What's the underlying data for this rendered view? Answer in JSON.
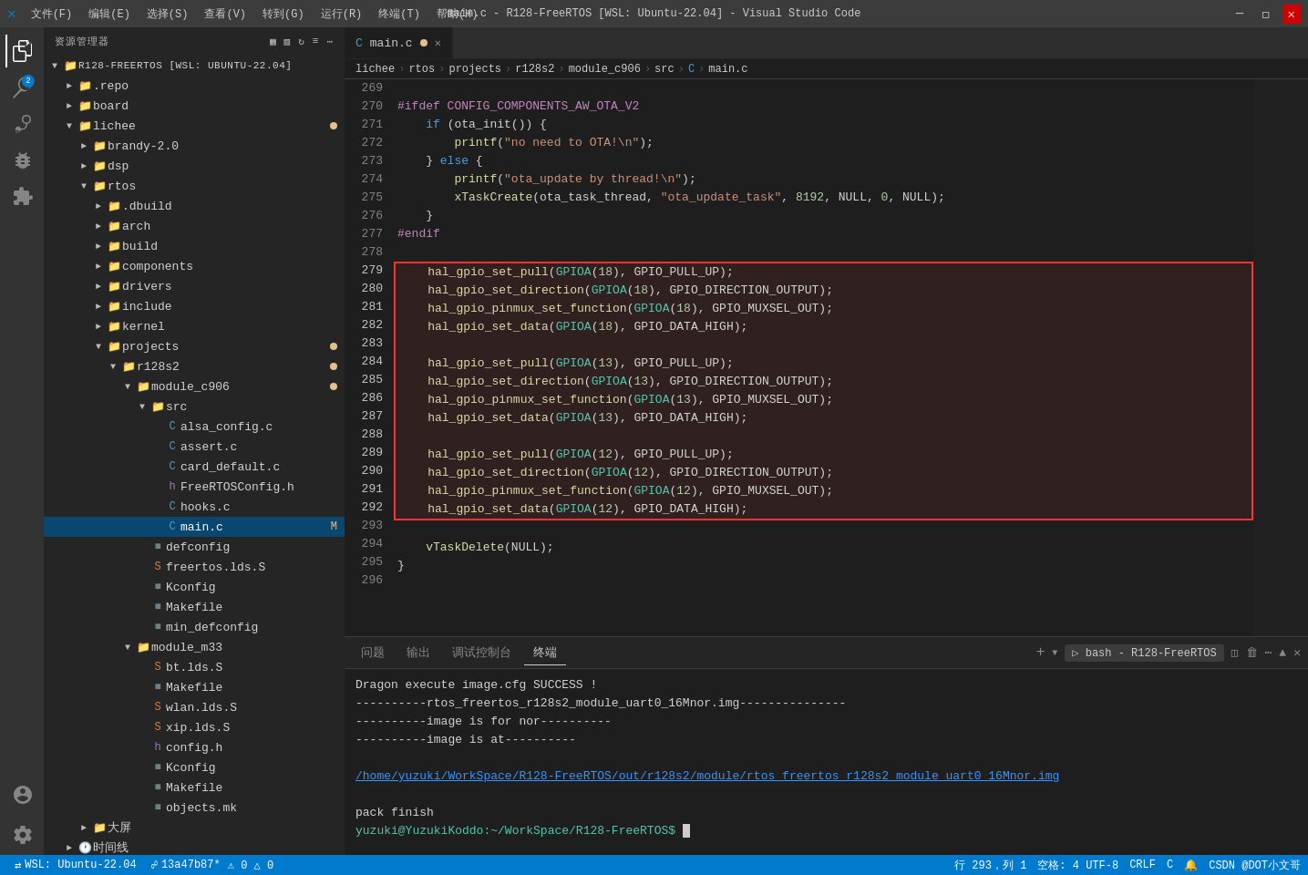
{
  "titlebar": {
    "title": "main.c - R128-FreeRTOS [WSL: Ubuntu-22.04] - Visual Studio Code",
    "menus": [
      "文件(F)",
      "编辑(E)",
      "选择(S)",
      "查看(V)",
      "转到(G)",
      "运行(R)",
      "终端(T)",
      "帮助(H)"
    ]
  },
  "sidebar": {
    "header": "资源管理器",
    "root": "R128-FREERTOS [WSL: UBUNTU-22.04]",
    "tree": [
      {
        "id": "repo",
        "label": ".repo",
        "type": "folder",
        "depth": 1,
        "expanded": false
      },
      {
        "id": "board",
        "label": "board",
        "type": "folder",
        "depth": 1,
        "expanded": false
      },
      {
        "id": "lichee",
        "label": "lichee",
        "type": "folder",
        "depth": 1,
        "expanded": true,
        "modified": true
      },
      {
        "id": "brandy",
        "label": "brandy-2.0",
        "type": "folder",
        "depth": 2,
        "expanded": false
      },
      {
        "id": "dsp",
        "label": "dsp",
        "type": "folder",
        "depth": 2,
        "expanded": false
      },
      {
        "id": "rtos",
        "label": "rtos",
        "type": "folder",
        "depth": 2,
        "expanded": true
      },
      {
        "id": "dbuild",
        "label": ".dbuild",
        "type": "folder",
        "depth": 3,
        "expanded": false
      },
      {
        "id": "arch",
        "label": "arch",
        "type": "folder",
        "depth": 3,
        "expanded": false
      },
      {
        "id": "build",
        "label": "build",
        "type": "folder",
        "depth": 3,
        "expanded": false,
        "special": true
      },
      {
        "id": "components",
        "label": "components",
        "type": "folder",
        "depth": 3,
        "expanded": false
      },
      {
        "id": "drivers",
        "label": "drivers",
        "type": "folder",
        "depth": 3,
        "expanded": false
      },
      {
        "id": "include",
        "label": "include",
        "type": "folder",
        "depth": 3,
        "expanded": false
      },
      {
        "id": "kernel",
        "label": "kernel",
        "type": "folder",
        "depth": 3,
        "expanded": false
      },
      {
        "id": "projects",
        "label": "projects",
        "type": "folder",
        "depth": 3,
        "expanded": true,
        "modified": true
      },
      {
        "id": "r128s2",
        "label": "r128s2",
        "type": "folder",
        "depth": 4,
        "expanded": true,
        "modified": true
      },
      {
        "id": "module_c906",
        "label": "module_c906",
        "type": "folder",
        "depth": 5,
        "expanded": true,
        "modified": true
      },
      {
        "id": "src",
        "label": "src",
        "type": "folder",
        "depth": 6,
        "expanded": true
      },
      {
        "id": "alsa_config.c",
        "label": "alsa_config.c",
        "type": "c",
        "depth": 7
      },
      {
        "id": "assert.c",
        "label": "assert.c",
        "type": "c",
        "depth": 7
      },
      {
        "id": "card_default.c",
        "label": "card_default.c",
        "type": "c",
        "depth": 7
      },
      {
        "id": "FreeRTOSConfig.h",
        "label": "FreeRTOSConfig.h",
        "type": "h",
        "depth": 7
      },
      {
        "id": "hooks.c",
        "label": "hooks.c",
        "type": "c",
        "depth": 7
      },
      {
        "id": "main.c",
        "label": "main.c",
        "type": "c",
        "depth": 7,
        "selected": true,
        "modified": true
      },
      {
        "id": "defconfig",
        "label": "defconfig",
        "type": "cfg",
        "depth": 6
      },
      {
        "id": "freertos.lds.S",
        "label": "freertos.lds.S",
        "type": "s",
        "depth": 6
      },
      {
        "id": "Kconfig",
        "label": "Kconfig",
        "type": "mk",
        "depth": 6
      },
      {
        "id": "Makefile",
        "label": "Makefile",
        "type": "mk",
        "depth": 6
      },
      {
        "id": "min_defconfig",
        "label": "min_defconfig",
        "type": "cfg",
        "depth": 6
      },
      {
        "id": "module_m33",
        "label": "module_m33",
        "type": "folder",
        "depth": 5,
        "expanded": true
      },
      {
        "id": "bt.lds.S",
        "label": "bt.lds.S",
        "type": "s",
        "depth": 6
      },
      {
        "id": "Makefile2",
        "label": "Makefile",
        "type": "mk",
        "depth": 6
      },
      {
        "id": "wlan.lds.S",
        "label": "wlan.lds.S",
        "type": "s",
        "depth": 6
      },
      {
        "id": "xip.lds.S",
        "label": "xip.lds.S",
        "type": "s",
        "depth": 6
      },
      {
        "id": "config.h",
        "label": "config.h",
        "type": "h",
        "depth": 6
      },
      {
        "id": "Kconfig2",
        "label": "Kconfig",
        "type": "mk",
        "depth": 6
      },
      {
        "id": "Makefile3",
        "label": "Makefile",
        "type": "mk",
        "depth": 6
      },
      {
        "id": "objects.mk",
        "label": "objects.mk",
        "type": "mk",
        "depth": 6
      }
    ]
  },
  "tabs": [
    {
      "id": "main.c",
      "label": "main.c",
      "active": true,
      "modified": true,
      "lang": "C"
    }
  ],
  "breadcrumb": [
    "lichee",
    "rtos",
    "projects",
    "r128s2",
    "module_c906",
    "src",
    "C",
    "main.c"
  ],
  "code": {
    "lines": [
      {
        "n": 269,
        "text": ""
      },
      {
        "n": 270,
        "text": "#ifdef CONFIG_COMPONENTS_AW_OTA_V2",
        "type": "pp"
      },
      {
        "n": 271,
        "text": "    if (ota_init()) {",
        "type": "mixed"
      },
      {
        "n": 272,
        "text": "        printf(\"no need to OTA!\\n\");",
        "type": "mixed"
      },
      {
        "n": 273,
        "text": "    } else {",
        "type": "mixed"
      },
      {
        "n": 274,
        "text": "        printf(\"ota_update by thread!\\n\");",
        "type": "mixed"
      },
      {
        "n": 275,
        "text": "        xTaskCreate(ota_task_thread, \"ota_update_task\", 8192, NULL, 0, NULL);",
        "type": "mixed"
      },
      {
        "n": 276,
        "text": "    }",
        "type": "plain"
      },
      {
        "n": 277,
        "text": "#endif",
        "type": "pp"
      },
      {
        "n": 278,
        "text": ""
      },
      {
        "n": 279,
        "text": "    hal_gpio_set_pull(GPIOA(18), GPIO_PULL_UP);",
        "type": "mixed",
        "highlight": true
      },
      {
        "n": 280,
        "text": "    hal_gpio_set_direction(GPIOA(18), GPIO_DIRECTION_OUTPUT);",
        "type": "mixed",
        "highlight": true
      },
      {
        "n": 281,
        "text": "    hal_gpio_pinmux_set_function(GPIOA(18), GPIO_MUXSEL_OUT);",
        "type": "mixed",
        "highlight": true
      },
      {
        "n": 282,
        "text": "    hal_gpio_set_data(GPIOA(18), GPIO_DATA_HIGH);",
        "type": "mixed",
        "highlight": true
      },
      {
        "n": 283,
        "text": "",
        "highlight": true
      },
      {
        "n": 284,
        "text": "    hal_gpio_set_pull(GPIOA(13), GPIO_PULL_UP);",
        "type": "mixed",
        "highlight": true
      },
      {
        "n": 285,
        "text": "    hal_gpio_set_direction(GPIOA(13), GPIO_DIRECTION_OUTPUT);",
        "type": "mixed",
        "highlight": true
      },
      {
        "n": 286,
        "text": "    hal_gpio_pinmux_set_function(GPIOA(13), GPIO_MUXSEL_OUT);",
        "type": "mixed",
        "highlight": true
      },
      {
        "n": 287,
        "text": "    hal_gpio_set_data(GPIOA(13), GPIO_DATA_HIGH);",
        "type": "mixed",
        "highlight": true
      },
      {
        "n": 288,
        "text": "",
        "highlight": true
      },
      {
        "n": 289,
        "text": "    hal_gpio_set_pull(GPIOA(12), GPIO_PULL_UP);",
        "type": "mixed",
        "highlight": true
      },
      {
        "n": 290,
        "text": "    hal_gpio_set_direction(GPIOA(12), GPIO_DIRECTION_OUTPUT);",
        "type": "mixed",
        "highlight": true
      },
      {
        "n": 291,
        "text": "    hal_gpio_pinmux_set_function(GPIOA(12), GPIO_MUXSEL_OUT);",
        "type": "mixed",
        "highlight": true
      },
      {
        "n": 292,
        "text": "    hal_gpio_set_data(GPIOA(12), GPIO_DATA_HIGH);",
        "type": "mixed",
        "highlight": true
      },
      {
        "n": 293,
        "text": ""
      },
      {
        "n": 294,
        "text": "    vTaskDelete(NULL);",
        "type": "mixed"
      },
      {
        "n": 295,
        "text": "}"
      },
      {
        "n": 296,
        "text": ""
      }
    ]
  },
  "terminal": {
    "tabs": [
      "问题",
      "输出",
      "调试控制台",
      "终端"
    ],
    "active_tab": "终端",
    "shell": "bash - R128-FreeRTOS",
    "content": [
      {
        "text": "Dragon execute image.cfg SUCCESS !",
        "color": "normal"
      },
      {
        "text": "----------rtos_freertos_r128s2_module_uart0_16Mnor.img-----------",
        "color": "normal"
      },
      {
        "text": "----------image is for nor----------",
        "color": "normal"
      },
      {
        "text": "----------image is at----------",
        "color": "normal"
      },
      {
        "text": "",
        "color": "normal"
      },
      {
        "text": "/home/yuzuki/WorkSpace/R128-FreeRTOS/out/r128s2/module/rtos_freertos_r128s2_module_uart0_16Mnor.img",
        "color": "link"
      },
      {
        "text": "",
        "color": "normal"
      },
      {
        "text": "pack finish",
        "color": "normal"
      },
      {
        "text": "yuzuki@YuzukiKoddo:~/WorkSpace/R128-FreeRTOS$",
        "color": "prompt",
        "cursor": true
      }
    ]
  },
  "statusbar": {
    "left": [
      "WSL: Ubuntu-22.04",
      "13a47b87*",
      "⚠ 0 △ 0"
    ],
    "right": [
      "行 293，列 1",
      "空格: 4  UTF-8",
      "CRLF",
      "C",
      "CSDN @DOT小文哥"
    ]
  }
}
